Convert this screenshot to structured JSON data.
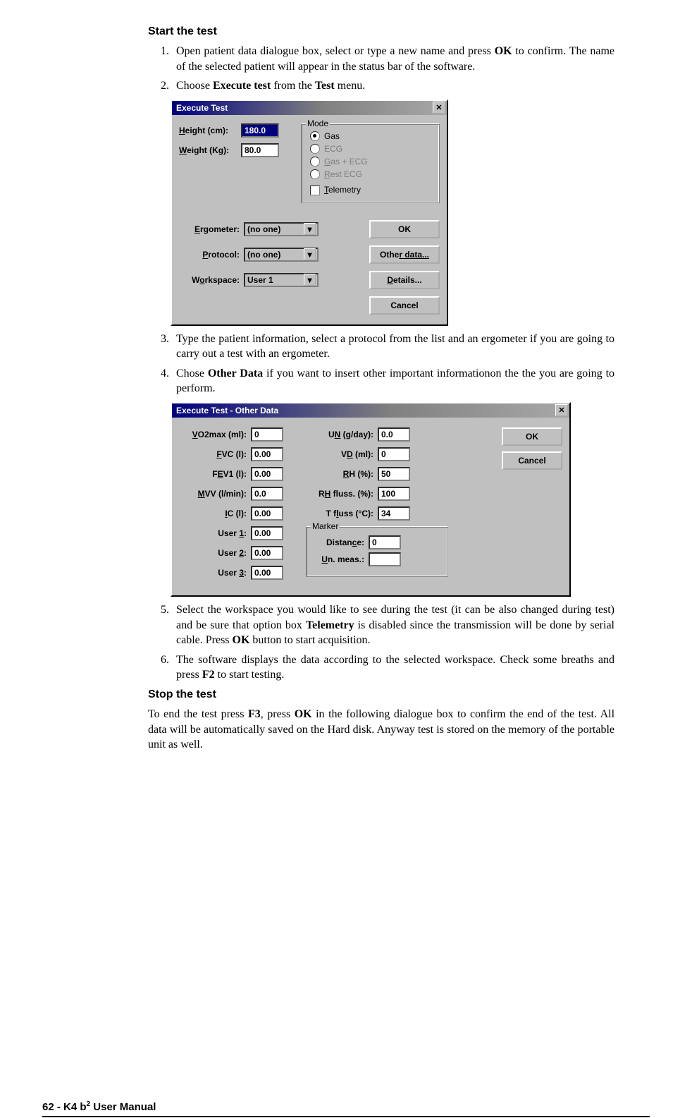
{
  "headings": {
    "start": "Start the test",
    "stop": "Stop the test"
  },
  "list": {
    "i1a": "Open patient data dialogue box, select or type a new name and press ",
    "i1b": " to confirm. The name of the selected patient will appear in the status bar of the software.",
    "i2a": "Choose ",
    "i2b": "Execute test",
    "i2c": " from the ",
    "i2d": "Test",
    "i2e": " menu.",
    "i3": "Type the patient information, select a protocol from the list and an ergometer  if you are going to carry out a test with an ergometer.",
    "i4a": "Chose ",
    "i4b": "Other Data",
    "i4c": " if you want to insert other important informationon the the you are going to perform.",
    "i5a": "Select the workspace you would like to see during the test (it can be also changed during test) and be sure that option box ",
    "i5b": "Telemetry",
    "i5c": " is disabled since the transmission will be done by serial cable. Press ",
    "i5d": "OK",
    "i5e": " button to start acquisition.",
    "i6a": "The software displays the data according to the selected workspace. Check some breaths and press ",
    "i6b": "F2",
    "i6c": " to start testing.",
    "ok": "OK"
  },
  "stop_p": {
    "a": "To end the test press ",
    "b": "F3",
    "c": ", press ",
    "d": "OK",
    "e": " in the following dialogue box to confirm the end of the test. All data will be automatically saved on the Hard disk. Anyway test is stored on the memory of the portable unit as well."
  },
  "dlg1": {
    "title": "Execute Test",
    "height_lbl": "eight (cm):",
    "height_u": "H",
    "height_val": "180.0",
    "weight_lbl": "eight (Kg):",
    "weight_u": "W",
    "weight_val": "80.0",
    "mode_legend": "Mode",
    "r_gas": "Gas",
    "r_ecg": "ECG",
    "r_gasecg": "as + ECG",
    "r_gasecg_u": "G",
    "r_rest": "est ECG",
    "r_rest_u": "R",
    "cb_tel": "elemetry",
    "cb_tel_u": "T",
    "erg_lbl": "rgometer:",
    "erg_u": "E",
    "erg_val": "(no one)",
    "prot_lbl": "rotocol:",
    "prot_u": "P",
    "prot_val": "(no one)",
    "work_lbl": "rkspace:",
    "work_pre": "W",
    "work_u": "o",
    "work_val": "User 1",
    "btn_ok": "OK",
    "btn_other": "r data...",
    "btn_other_pre": "Othe",
    "btn_details": "etails...",
    "btn_details_u": "D",
    "btn_cancel": "Cancel"
  },
  "dlg2": {
    "title": "Execute Test - Other Data",
    "vo2_u": "V",
    "vo2_lbl": "O2max (ml):",
    "vo2": "0",
    "fvc_u": "F",
    "fvc_lbl": "VC (l):",
    "fvc": "0.00",
    "fev_pre": "F",
    "fev_u": "E",
    "fev_lbl": "V1 (l):",
    "fev": "0.00",
    "mvv_u": "M",
    "mvv_lbl": "VV (l/min):",
    "mvv": "0.0",
    "ic_u": "I",
    "ic_lbl": "C (l):",
    "ic": "0.00",
    "u1_lbl": "User ",
    "u1_u": "1",
    "u1_tail": ":",
    "u1": "0.00",
    "u2_lbl": "User ",
    "u2_u": "2",
    "u2_tail": ":",
    "u2": "0.00",
    "u3_lbl": "User ",
    "u3_u": "3",
    "u3_tail": ":",
    "u3": "0.00",
    "un_pre": "U",
    "un_u": "N",
    "un_lbl": " (g/day):",
    "un": "0.0",
    "vd_pre": "V",
    "vd_u": "D",
    "vd_lbl": " (ml):",
    "vd": "0",
    "rh_u": "R",
    "rh_lbl": "H (%):",
    "rh": "50",
    "rhf_pre": "R",
    "rhf_u": "H",
    "rhf_lbl": " fluss. (%):",
    "rhf": "100",
    "tf_pre": "T f",
    "tf_u": "l",
    "tf_lbl": "uss (°C):",
    "tf": "34",
    "marker_legend": "Marker",
    "dist_pre": "Distan",
    "dist_u": "c",
    "dist_lbl": "e:",
    "dist": "0",
    "unm_u": "U",
    "unm_lbl": "n. meas.:",
    "unm": "",
    "btn_ok": "OK",
    "btn_cancel": "Cancel"
  },
  "footer": {
    "pageno": "62",
    "sep": " - ",
    "manual_pre": "K4 b",
    "manual_sup": "2",
    "manual_post": " User Manual"
  }
}
